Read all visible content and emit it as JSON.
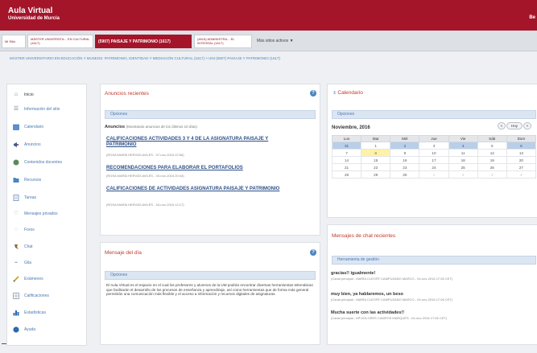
{
  "header": {
    "title": "Aula Virtual",
    "subtitle": "Universidad de Murcia",
    "right_text": "Be"
  },
  "tabs": [
    {
      "label": "Mi Sitio"
    },
    {
      "label": "MÁSTER UNIVERSITA... EN CULTURAL (1617)"
    },
    {
      "label": "(5907) PAISAJE Y PATRIMONIO (1617)"
    },
    {
      "label": "(4615) ADMINISTRA... EL INTEGRAL (1617)"
    },
    {
      "label": "Más sitios activos ▼"
    }
  ],
  "breadcrumb": "MÁSTER UNIVERSITARIO EN EDUCACIÓN Y MUSEOS: PATRIMONIO, IDENTIDAD Y MEDIACIÓN CULTURAL (1617) > UNI (5907) PAISAJE Y PATRIMONIO (1617)",
  "sidebar": {
    "items": [
      {
        "label": "Inicio",
        "icon": "home-icon"
      },
      {
        "label": "Información del sitio",
        "icon": "info-icon"
      },
      {
        "label": "Calendario",
        "icon": "calendar-icon"
      },
      {
        "label": "Anuncios",
        "icon": "megaphone-icon"
      },
      {
        "label": "Contenidos docentes",
        "icon": "content-icon"
      },
      {
        "label": "Recursos",
        "icon": "folder-icon"
      },
      {
        "label": "Tareas",
        "icon": "tasks-icon"
      },
      {
        "label": "Mensajes privados",
        "icon": "heart-icon"
      },
      {
        "label": "Foros",
        "icon": "forum-icon"
      },
      {
        "label": "Chat",
        "icon": "chat-icon"
      },
      {
        "label": "Glia",
        "icon": "glia-icon"
      },
      {
        "label": "Exámenes",
        "icon": "pencil-icon"
      },
      {
        "label": "Calificaciones",
        "icon": "grades-icon"
      },
      {
        "label": "Estadísticas",
        "icon": "stats-icon"
      },
      {
        "label": "Ayuda",
        "icon": "help-icon"
      }
    ]
  },
  "announcements": {
    "title": "Anuncios recientes",
    "options_label": "Opciones",
    "heading": "Anuncios",
    "heading_note": "(Mostrando anuncios de los últimos 10 días)",
    "items": [
      {
        "title": "CALIFICACIONES ACTIVIDADES 3 Y 4 DE LA ASIGNATURA PAISAJE Y PATRIMONIO",
        "meta": "(ROSA MARÍA HERVÁS AVILÉS - 07-nov-2016 22:56)"
      },
      {
        "title": "RECOMENDACIONES PARA ELABORAR EL PORTAFOLIOS",
        "meta": "(ROSA MARÍA HERVÁS AVILÉS - 03-nov-2016 20:44)"
      },
      {
        "title": "CALIFICACIONES DE ACTIVIDADES ASIGNATURA PAISAJE Y PATRIMONIO",
        "meta": "(ROSA MARÍA HERVÁS AVILÉS - 04-nov-2016 12:17)"
      }
    ]
  },
  "message_of_day": {
    "title": "Mensaje del día",
    "options_label": "Opciones",
    "text": "El Aula Virtual es el espacio en el cual los profesores y alumnos de la UM podrán encontrar diversas herramientas telemáticas que facilitarán el desarrollo de los procesos de enseñanza y aprendizaje, así como herramientas que de forma más general permitirán una comunicación más flexible y el acceso a información y recursos digitales de asignaturas."
  },
  "calendar": {
    "title": "Calendario",
    "options_label": "Opciones",
    "month_label": "Noviembre, 2016",
    "buttons": [
      "<",
      "Hoy",
      ">"
    ],
    "weekdays": [
      "Lun",
      "Mar",
      "Mié",
      "Jue",
      "Vie",
      "Sáb",
      "Dom"
    ],
    "weeks": [
      [
        "31",
        "1",
        "2",
        "3",
        "4",
        "5",
        "6"
      ],
      [
        "7",
        "8",
        "9",
        "10",
        "11",
        "12",
        "13"
      ],
      [
        "14",
        "15",
        "16",
        "17",
        "18",
        "19",
        "20"
      ],
      [
        "21",
        "22",
        "23",
        "24",
        "25",
        "26",
        "27"
      ],
      [
        "28",
        "29",
        "30",
        "1",
        "2",
        "3",
        "4"
      ]
    ]
  },
  "chat": {
    "title": "Mensajes de chat recientes",
    "options_label": "Herramienta de gestión",
    "messages": [
      {
        "text": "gracias!! igualmente!",
        "meta": "(Canal principal - MARÍA CLEOFÉ CAMPUZANO MARCO - 04-nov-2016 17:06 CET)"
      },
      {
        "text": "muy bien, ya hablaremos, un beso",
        "meta": "(Canal principal - MARÍA CLEOFÉ CAMPUZANO MARCO - 04-nov-2016 17:06 CET)"
      },
      {
        "text": "Mucha suerte con las actividades!!",
        "meta": "(Canal principal - Mª DOLORES CAMPOS MARQUÉS - 04-nov-2016 17:06 CET)"
      }
    ]
  }
}
